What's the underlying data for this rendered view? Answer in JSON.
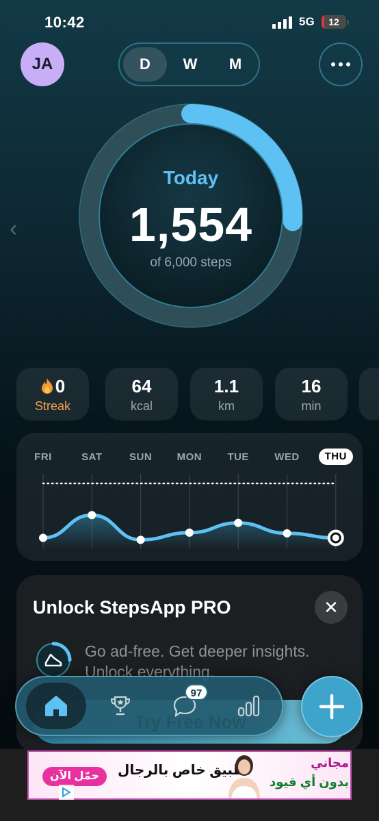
{
  "status_bar": {
    "time": "10:42",
    "network": "5G",
    "battery_level": "12",
    "battery_fraction": 0.12,
    "battery_color": "#e5343b"
  },
  "header": {
    "avatar_initials": "JA",
    "periods": [
      "D",
      "W",
      "M"
    ],
    "active_period": "D",
    "more_icon": "ellipsis-icon"
  },
  "progress": {
    "label": "Today",
    "steps": "1,554",
    "goal_text": "of 6,000 steps",
    "fraction": 0.259,
    "accent_color": "#5ec1f3"
  },
  "stats": [
    {
      "value": "0",
      "label": "Streak",
      "icon": "flame-icon"
    },
    {
      "value": "64",
      "label": "kcal"
    },
    {
      "value": "1.1",
      "label": "km"
    },
    {
      "value": "16",
      "label": "min"
    }
  ],
  "week": {
    "days": [
      "FRI",
      "SAT",
      "SUN",
      "MON",
      "TUE",
      "WED",
      "THU"
    ],
    "today": "THU",
    "relative_steps": [
      0.1,
      0.45,
      0.07,
      0.18,
      0.33,
      0.17,
      0.1
    ]
  },
  "promo": {
    "title": "Unlock StepsApp PRO",
    "body": "Go ad-free. Get deeper insights. Unlock everything.",
    "cta": "Try Free Now",
    "icon": "shoe-icon"
  },
  "tabbar": {
    "tabs": [
      "home-icon",
      "trophy-icon",
      "chat-icon",
      "stats-icon"
    ],
    "active": "home-icon",
    "chat_badge": "97",
    "fab_icon": "plus-icon"
  },
  "ad": {
    "cta": "حمّل الآن",
    "headline": "تطبيق خاص بالرجال",
    "free": "مجاني",
    "no_limits": "بدون أي قيود",
    "pink": "#e8319e",
    "green": "#0f7d2c"
  }
}
